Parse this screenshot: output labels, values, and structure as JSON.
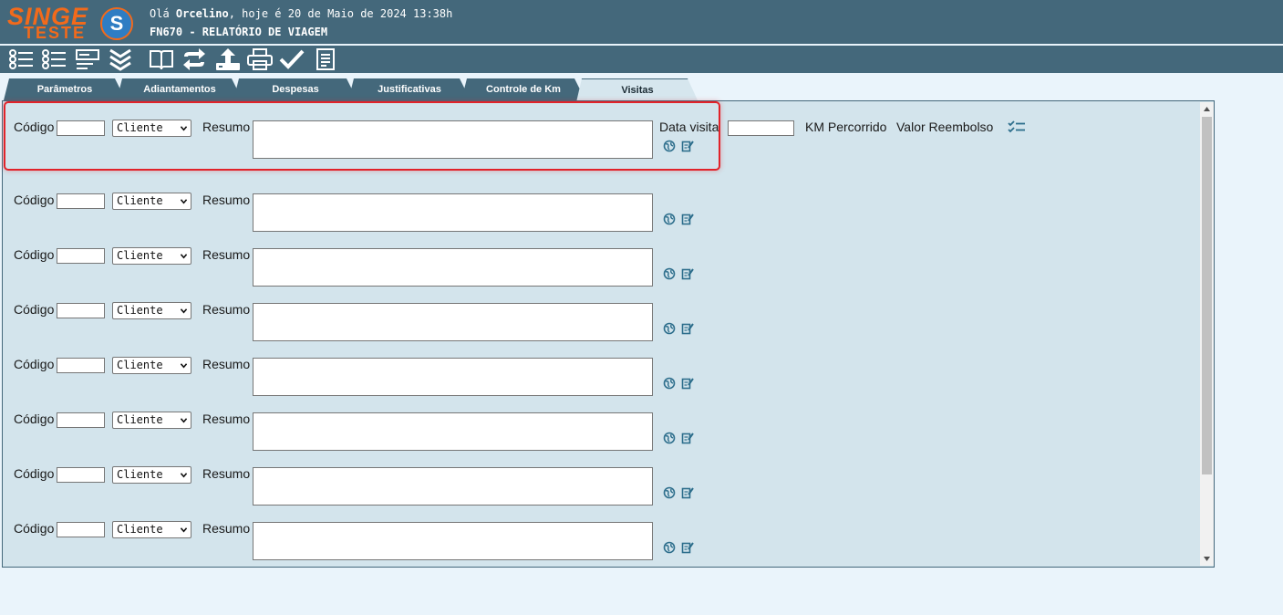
{
  "logo": {
    "brand": "SINGE",
    "edition": "TESTE",
    "badge": "S"
  },
  "header": {
    "greeting_prefix": "Olá ",
    "user": "Orcelino",
    "greeting_suffix": ", hoje é 20 de Maio de 2024 13:38h",
    "screen_title": "FN670 - RELATÓRIO DE VIAGEM"
  },
  "toolbar": {
    "icons": [
      "list-icon",
      "list-check-icon",
      "form-icon",
      "expand-all-icon",
      "book-icon",
      "refresh-icon",
      "upload-icon",
      "print-icon",
      "check-icon",
      "document-icon"
    ]
  },
  "tabs": [
    {
      "label": "Parâmetros"
    },
    {
      "label": "Adiantamentos"
    },
    {
      "label": "Despesas"
    },
    {
      "label": "Justificativas"
    },
    {
      "label": "Controle de Km"
    },
    {
      "label": "Visitas",
      "active": true
    }
  ],
  "visit_form": {
    "codigo_label": "Código",
    "tipo_selected": "Cliente",
    "resumo_label": "Resumo",
    "data_visita_label": "Data visita",
    "km_label": "KM Percorrido",
    "valor_label": "Valor Reembolso"
  },
  "rows": [
    {
      "codigo": "",
      "tipo": "Cliente",
      "resumo": ""
    },
    {
      "codigo": "",
      "tipo": "Cliente",
      "resumo": ""
    },
    {
      "codigo": "",
      "tipo": "Cliente",
      "resumo": ""
    },
    {
      "codigo": "",
      "tipo": "Cliente",
      "resumo": ""
    },
    {
      "codigo": "",
      "tipo": "Cliente",
      "resumo": ""
    },
    {
      "codigo": "",
      "tipo": "Cliente",
      "resumo": ""
    },
    {
      "codigo": "",
      "tipo": "Cliente",
      "resumo": ""
    },
    {
      "codigo": "",
      "tipo": "Cliente",
      "resumo": ""
    }
  ],
  "colors": {
    "header": "#44687b",
    "panel": "#d3e4ec",
    "accent": "#f26a1b",
    "highlight": "#e1232a",
    "icon": "#2d6e8c"
  }
}
